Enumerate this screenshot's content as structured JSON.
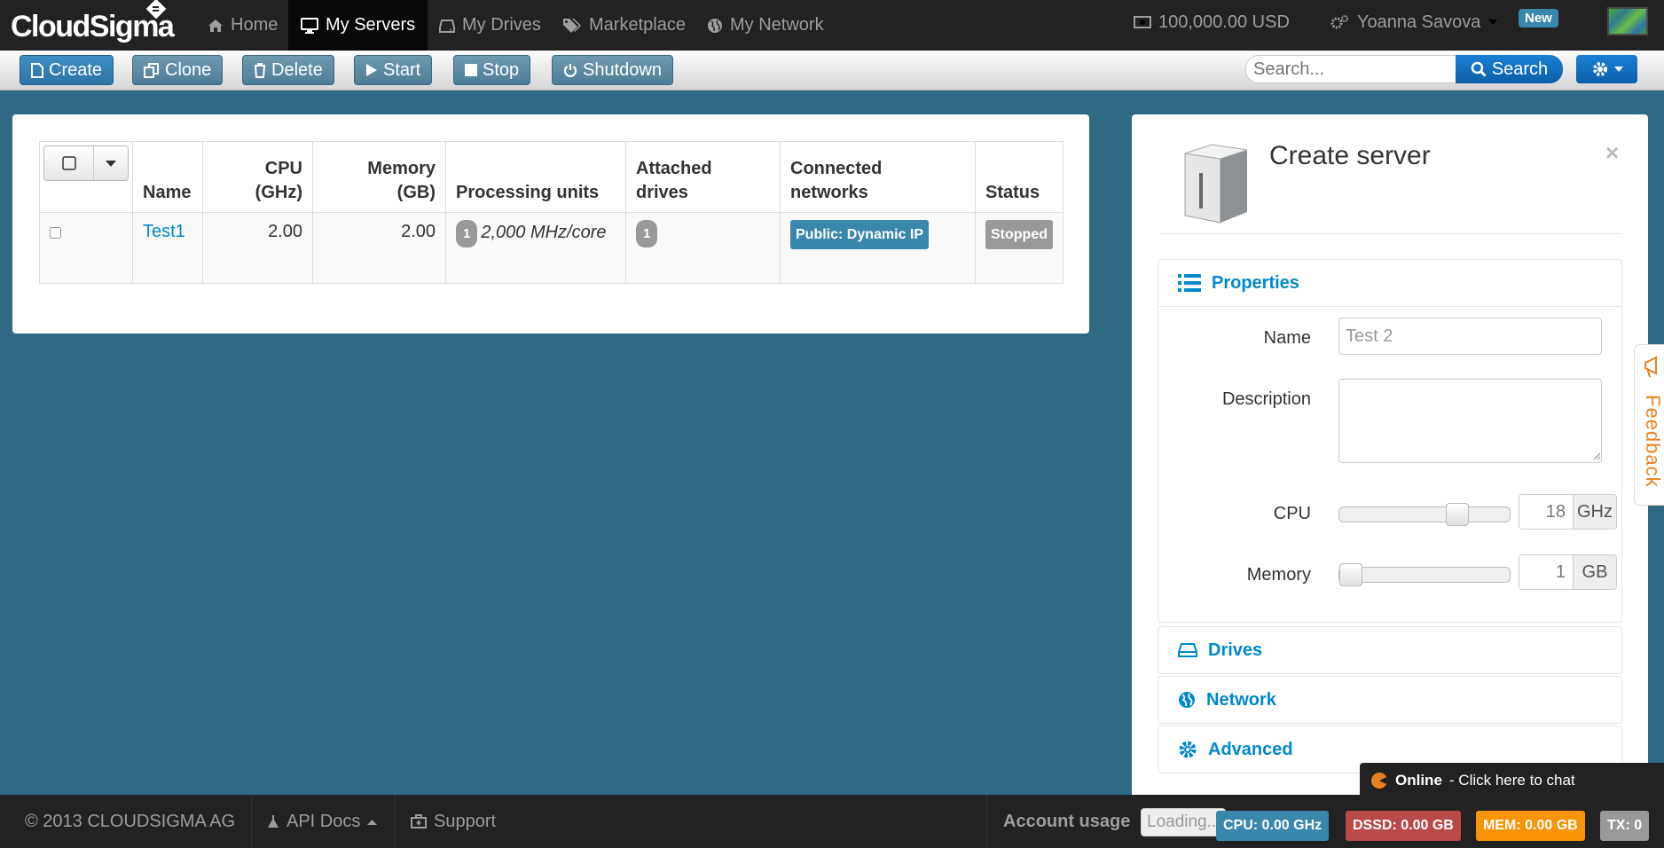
{
  "topbar": {
    "logo": "CloudSigma",
    "nav": [
      {
        "label": "Home",
        "icon": "home-icon"
      },
      {
        "label": "My Servers",
        "icon": "monitor-icon",
        "active": true
      },
      {
        "label": "My Drives",
        "icon": "hdd-icon"
      },
      {
        "label": "Marketplace",
        "icon": "tags-icon"
      },
      {
        "label": "My Network",
        "icon": "globe-icon"
      }
    ],
    "balance": "100,000.00 USD",
    "user": "Yoanna Savova",
    "new_badge": "New"
  },
  "toolbar": {
    "buttons": [
      "Create",
      "Clone",
      "Delete",
      "Start",
      "Stop",
      "Shutdown"
    ],
    "search_placeholder": "Search...",
    "search_label": "Search"
  },
  "servers_table": {
    "columns": [
      "Name",
      "CPU (GHz)",
      "Memory (GB)",
      "Processing units",
      "Attached drives",
      "Connected networks",
      "Status"
    ],
    "column_lines": {
      "cpu": [
        "CPU",
        "(GHz)"
      ],
      "memory": [
        "Memory",
        "(GB)"
      ],
      "attached": [
        "Attached",
        "drives"
      ],
      "connected": [
        "Connected",
        "networks"
      ]
    },
    "rows": [
      {
        "name": "Test1",
        "cpu": "2.00",
        "memory": "2.00",
        "processing_units_count": "1",
        "processing_units_text": "2,000 MHz/core",
        "attached_drives": "1",
        "network": "Public: Dynamic IP",
        "status": "Stopped"
      }
    ]
  },
  "create_panel": {
    "title": "Create server",
    "close": "×",
    "properties_label": "Properties",
    "name_label": "Name",
    "name_value": "Test 2",
    "description_label": "Description",
    "cpu_label": "CPU",
    "cpu_value": "18",
    "cpu_unit": "GHz",
    "cpu_slider_fraction": 0.72,
    "memory_label": "Memory",
    "memory_value": "1",
    "memory_unit": "GB",
    "memory_slider_fraction": 0.0,
    "drives_label": "Drives",
    "network_label": "Network",
    "advanced_label": "Advanced"
  },
  "feedback": "Feedback",
  "chat": {
    "status": "Online",
    "text": "- Click here to chat"
  },
  "footer": {
    "copyright": "© 2013 CLOUDSIGMA AG",
    "api_docs": "API Docs",
    "support": "Support",
    "account_usage": "Account usage",
    "loading": "Loading...",
    "usage": [
      {
        "label": "CPU: 0.00 GHz",
        "color": "#3a87ad"
      },
      {
        "label": "DSSD: 0.00 GB",
        "color": "#b94a48"
      },
      {
        "label": "MEM: 0.00 GB",
        "color": "#f89406"
      },
      {
        "label": "TX: 0",
        "color": "#999999"
      }
    ]
  },
  "colors": {
    "background": "#2e6a84",
    "topbar": "#222222",
    "link": "#0088cc",
    "network_label": "#3a87ad",
    "status_label": "#999999"
  }
}
